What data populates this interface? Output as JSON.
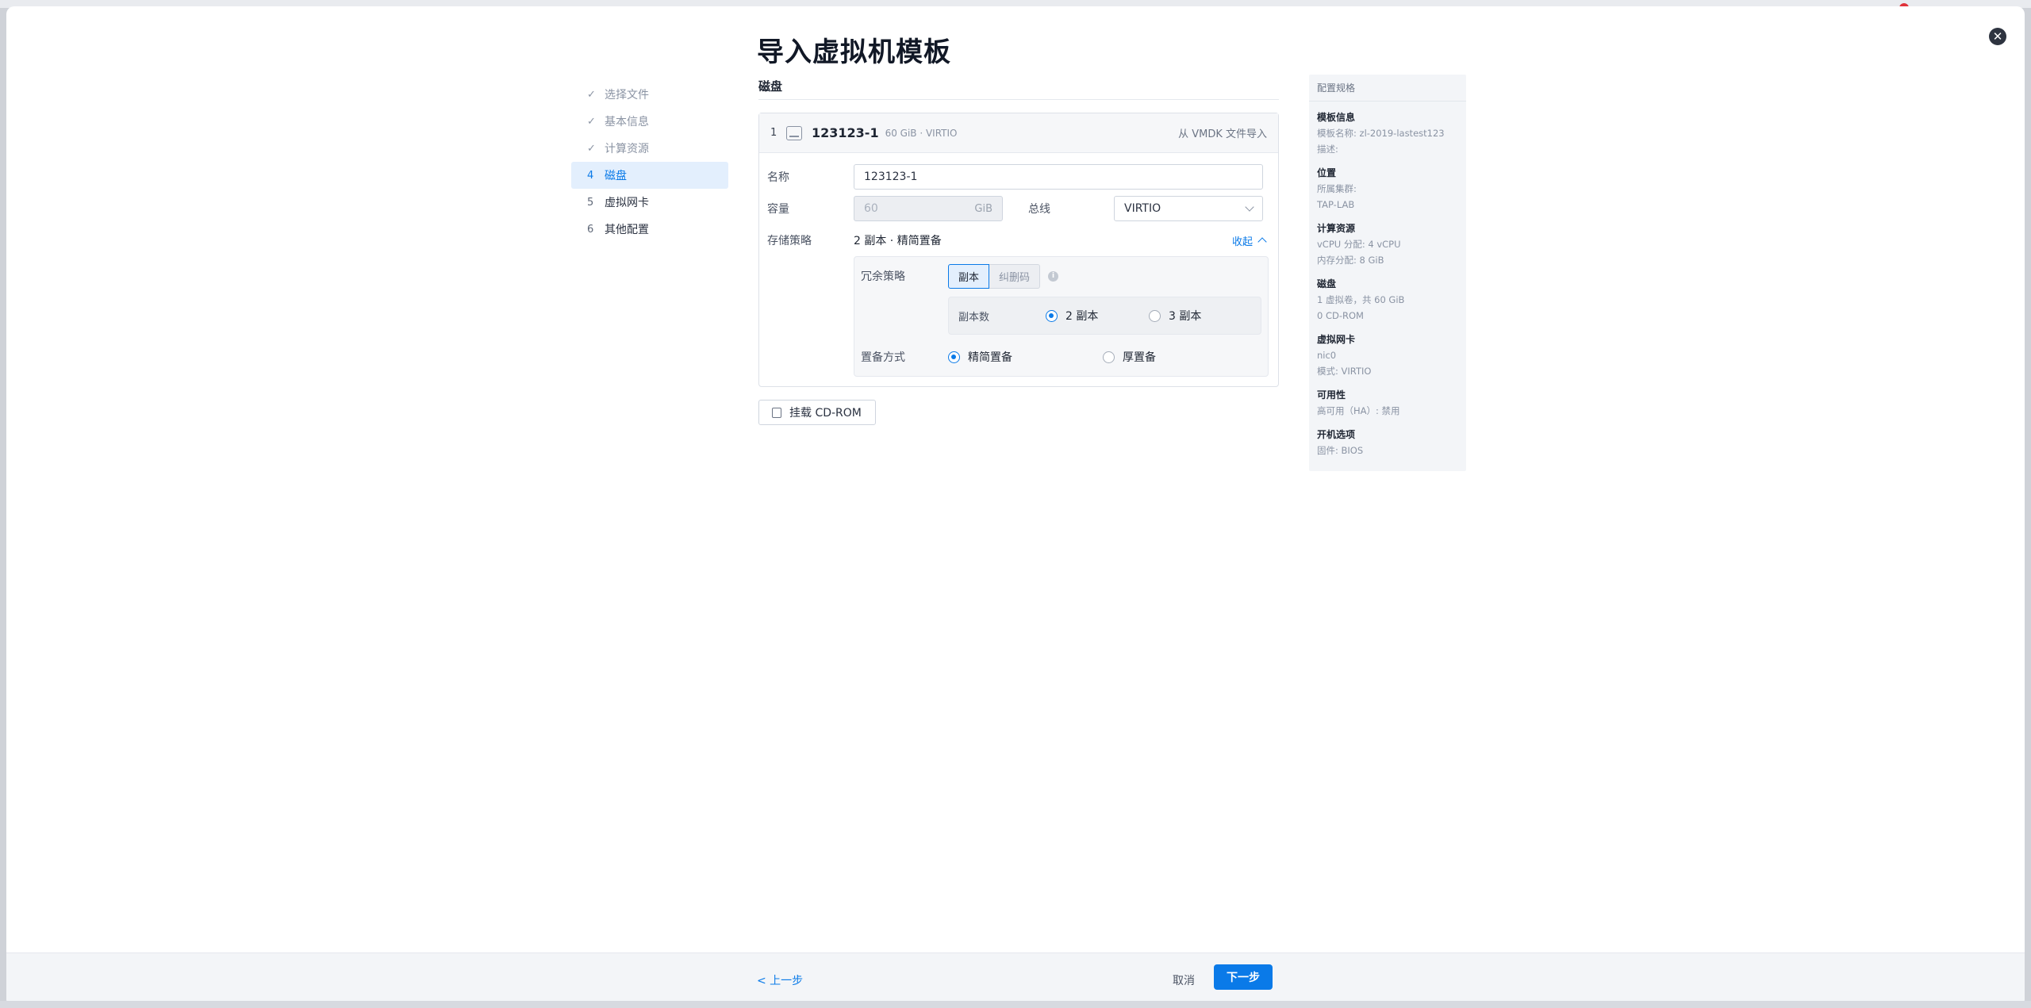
{
  "title": "导入虚拟机模板",
  "steps": [
    {
      "mark": "✓",
      "label": "选择文件"
    },
    {
      "mark": "✓",
      "label": "基本信息"
    },
    {
      "mark": "✓",
      "label": "计算资源"
    },
    {
      "mark": "4",
      "label": "磁盘"
    },
    {
      "mark": "5",
      "label": "虚拟网卡"
    },
    {
      "mark": "6",
      "label": "其他配置"
    }
  ],
  "section_title": "磁盘",
  "disk": {
    "index": "1",
    "name": "123123-1",
    "meta": "60 GiB · VIRTIO",
    "source": "从 VMDK 文件导入",
    "name_label": "名称",
    "name_value": "123123-1",
    "capacity_label": "容量",
    "capacity_value": "60",
    "capacity_unit": "GiB",
    "bus_label": "总线",
    "bus_value": "VIRTIO",
    "policy_label": "存储策略",
    "policy_value": "2 副本 · 精简置备",
    "collapse_label": "收起",
    "redundancy_label": "冗余策略",
    "redundancy_options": [
      "副本",
      "纠删码"
    ],
    "replica_label": "副本数",
    "replica_options": [
      "2 副本",
      "3 副本"
    ],
    "provision_label": "置备方式",
    "provision_options": [
      "精简置备",
      "厚置备"
    ]
  },
  "cdrom_button": "挂载 CD-ROM",
  "summary": {
    "header": "配置规格",
    "sections": [
      {
        "title": "模板信息",
        "lines": [
          "模板名称: zl-2019-lastest123",
          "描述: "
        ]
      },
      {
        "title": "位置",
        "lines": [
          "所属集群:",
          "TAP-LAB"
        ]
      },
      {
        "title": "计算资源",
        "lines": [
          "vCPU 分配: 4 vCPU",
          "内存分配: 8 GiB"
        ]
      },
      {
        "title": "磁盘",
        "lines": [
          "1 虚拟卷，共 60 GiB",
          "0 CD-ROM"
        ]
      },
      {
        "title": "虚拟网卡",
        "lines": [
          "nic0",
          "模式: VIRTIO"
        ]
      },
      {
        "title": "可用性",
        "lines": [
          "高可用（HA）: 禁用"
        ]
      },
      {
        "title": "开机选项",
        "lines": [
          "固件: BIOS"
        ]
      }
    ]
  },
  "footer": {
    "prev": "< 上一步",
    "cancel": "取消",
    "next": "下一步"
  },
  "colors": {
    "accent": "#0a7ae8",
    "close_bg": "#2e3440"
  },
  "icons": {
    "close": "close-icon",
    "check": "check-icon",
    "disk": "disk-icon",
    "info": "info-icon",
    "cdrom": "cdrom-icon",
    "chevron_down": "chevron-down-icon",
    "chevron_up": "chevron-up-icon"
  }
}
